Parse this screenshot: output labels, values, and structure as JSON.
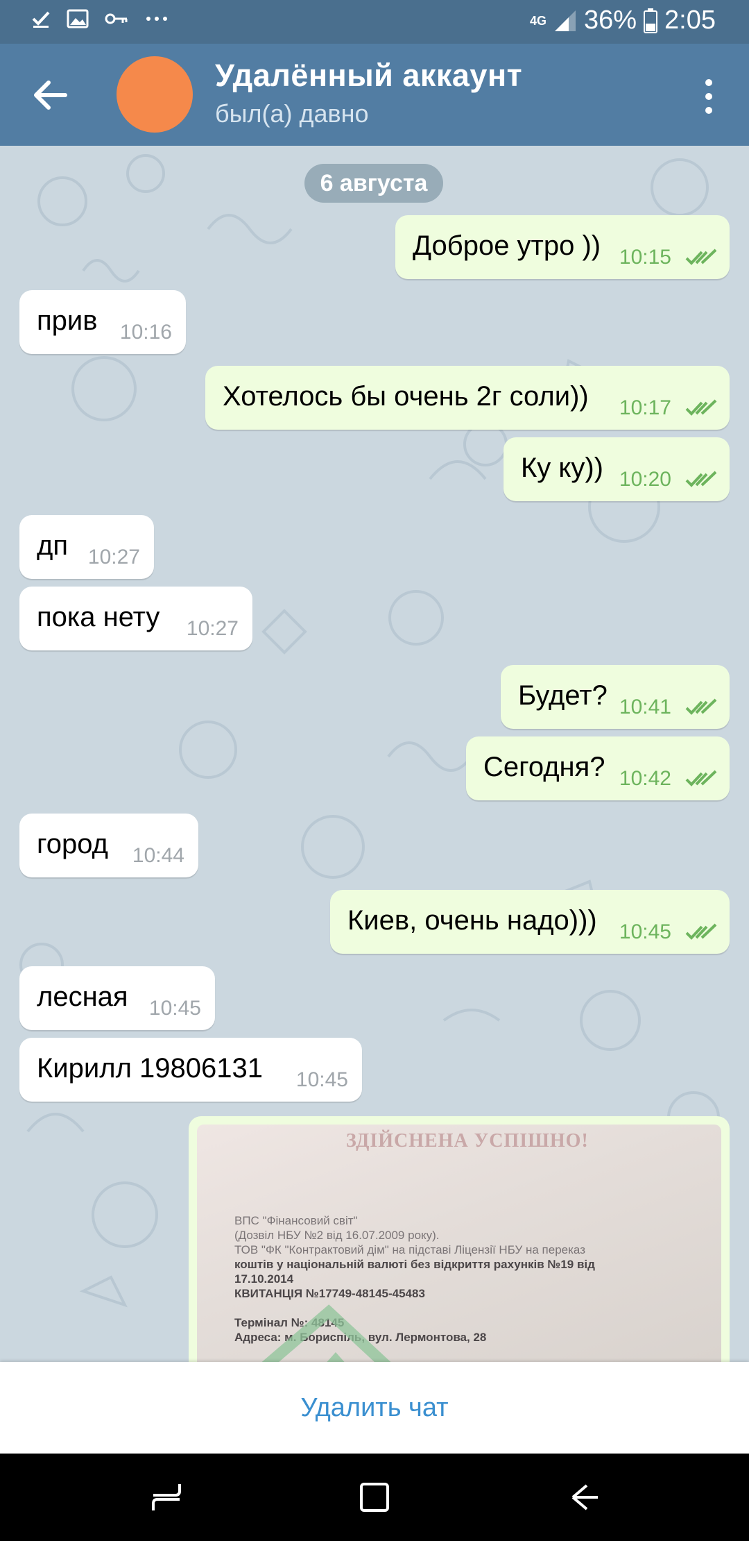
{
  "status_bar": {
    "network": "4G",
    "battery": "36%",
    "time": "2:05",
    "icons": [
      "check-icon",
      "image-icon",
      "key-icon",
      "more-icon",
      "signal-icon",
      "battery-icon"
    ]
  },
  "header": {
    "title": "Удалённый аккаунт",
    "subtitle": "был(а) давно",
    "avatar_color": "#f5894b"
  },
  "chat": {
    "date_label": "6 августа",
    "messages": [
      {
        "dir": "out",
        "text": "Доброе утро ))",
        "time": "10:15"
      },
      {
        "dir": "in",
        "text": "прив",
        "time": "10:16"
      },
      {
        "dir": "out",
        "text": "Хотелось бы очень 2г соли))",
        "time": "10:17"
      },
      {
        "dir": "out",
        "text": "Ку ку))",
        "time": "10:20"
      },
      {
        "dir": "in",
        "text": "дп",
        "time": "10:27"
      },
      {
        "dir": "in",
        "text": "пока нету",
        "time": "10:27"
      },
      {
        "dir": "out",
        "text": "Будет?",
        "time": "10:41"
      },
      {
        "dir": "out",
        "text": "Сегодня?",
        "time": "10:42"
      },
      {
        "dir": "in",
        "text": "город",
        "time": "10:44"
      },
      {
        "dir": "out",
        "text": "Киев, очень надо)))",
        "time": "10:45"
      },
      {
        "dir": "in",
        "text": "лесная",
        "time": "10:45"
      },
      {
        "dir": "in",
        "text": "Кирилл 19806131",
        "time": "10:45"
      }
    ],
    "photo": {
      "title": "ЗДІЙСНЕНА УСПІШНО!",
      "lines": [
        "ВПС \"Фінансовий світ\"",
        "(Дозвіл НБУ №2 від 16.07.2009 року).",
        "ТОВ \"ФК \"Контрактовий дім\" на підставі Ліцензії НБУ на переказ",
        "коштів у національній валюті без відкриття рахунків №19 від",
        "17.10.2014",
        "КВИТАНЦІЯ №17749-48145-45483",
        "",
        "Термінал №: 48145",
        "Адреса: м. Бориспіль, вул. Лермонтова, 28"
      ]
    }
  },
  "actions": {
    "delete_chat": "Удалить чат"
  },
  "colors": {
    "header": "#527da3",
    "status_bar": "#4a6f8e",
    "outgoing_bubble": "#effdde",
    "incoming_bubble": "#ffffff",
    "accent": "#3a8fd0",
    "read_ticks": "#6db45d"
  }
}
